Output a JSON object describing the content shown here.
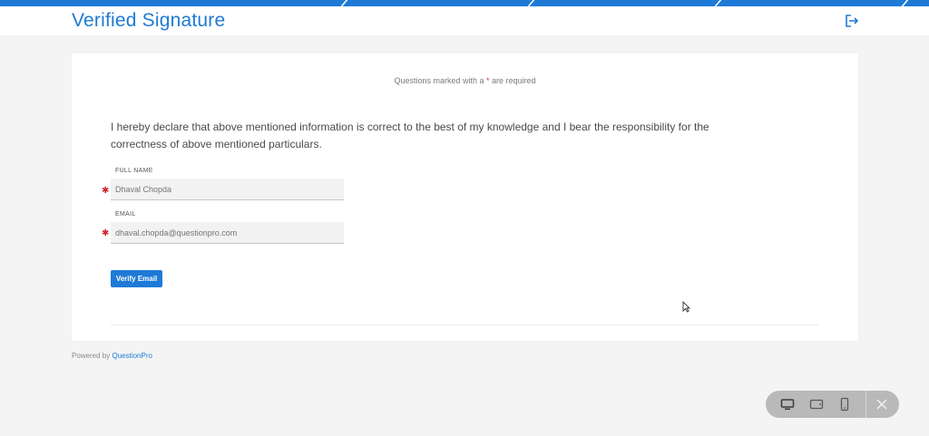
{
  "header": {
    "title": "Verified Signature",
    "logout_icon": "logout-icon"
  },
  "form": {
    "required_note_prefix": "Questions marked with a ",
    "required_note_star": "*",
    "required_note_suffix": " are required",
    "declaration": "I hereby declare that above mentioned information is correct to the best of my knowledge and I bear the responsibility for the correctness of above mentioned particulars.",
    "fields": [
      {
        "label": "FULL NAME",
        "placeholder": "Dhaval Chopda",
        "required": true
      },
      {
        "label": "EMAIL",
        "placeholder": "dhaval.chopda@questionpro.com",
        "required": true
      }
    ],
    "verify_button": "Verify Email"
  },
  "footer": {
    "powered_prefix": "Powered by ",
    "powered_link": "QuestionPro"
  },
  "device_toolbar": {
    "icons": [
      "desktop-icon",
      "tablet-landscape-icon",
      "mobile-icon",
      "close-icon"
    ]
  },
  "colors": {
    "accent": "#1e7ad6",
    "required": "#e0313b",
    "background": "#f4f4f4"
  }
}
